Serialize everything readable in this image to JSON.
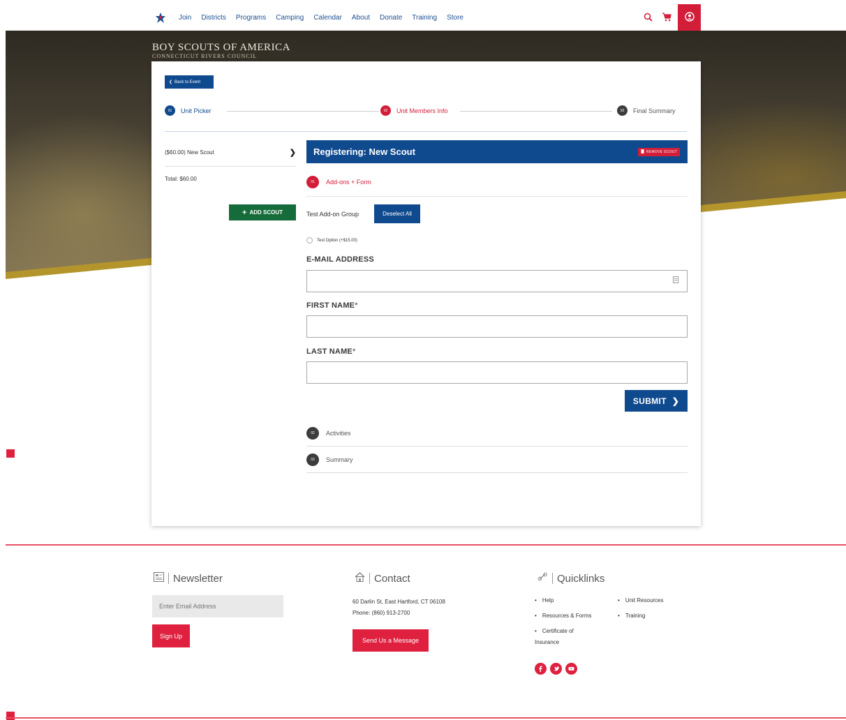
{
  "nav": {
    "links": [
      "Join",
      "Districts",
      "Programs",
      "Camping",
      "Calendar",
      "About",
      "Donate",
      "Training",
      "Store"
    ]
  },
  "brand": {
    "title": "BOY SCOUTS OF AMERICA",
    "subtitle": "CONNECTICUT RIVERS COUNCIL"
  },
  "card": {
    "back_label": "Back to Event",
    "steps": [
      {
        "num": "01",
        "label": "Unit Picker",
        "color": "#104a8e"
      },
      {
        "num": "02",
        "label": "Unit Members Info",
        "color": "#d31e39"
      },
      {
        "num": "03",
        "label": "Final Summary",
        "color": "#3c3c3c"
      }
    ],
    "sidebar": {
      "scout_line": "($60.00) New Scout",
      "total": "Total: $60.00",
      "add_label": "ADD SCOUT"
    },
    "registering": {
      "title": "Registering: New Scout",
      "remove_label": "REMOVE SCOUT"
    },
    "section": {
      "num": "01",
      "label": "Add-ons + Form"
    },
    "addon_group": "Test Add-on Group",
    "deselect_label": "Deselect All",
    "option_label": "Test Option (+$15.00)",
    "fields": {
      "email_label": "E-MAIL ADDRESS",
      "email_value": "",
      "first_label": "FIRST NAME",
      "first_value": "",
      "last_label": "LAST NAME",
      "last_value": "",
      "required_mark": "*"
    },
    "submit_label": "SUBMIT",
    "collapsed": [
      {
        "num": "02",
        "label": "Activities"
      },
      {
        "num": "03",
        "label": "Summary"
      }
    ]
  },
  "footer": {
    "newsletter": {
      "title": "Newsletter",
      "placeholder": "Enter Email Address",
      "signup_label": "Sign Up"
    },
    "contact": {
      "title": "Contact",
      "address": "60 Darlin St, East Hartford, CT 06108",
      "phone": "Phone: (860) 913-2700",
      "message_label": "Send Us a Message"
    },
    "quicklinks": {
      "title": "Quicklinks",
      "col1": [
        "Help",
        "Resources & Forms",
        "Certificate of",
        "Insurance"
      ],
      "col2": [
        "Unit Resources",
        "Training"
      ]
    }
  },
  "colors": {
    "brand_blue": "#104a8e",
    "brand_red": "#d31e39",
    "add_green": "#156c3a"
  }
}
